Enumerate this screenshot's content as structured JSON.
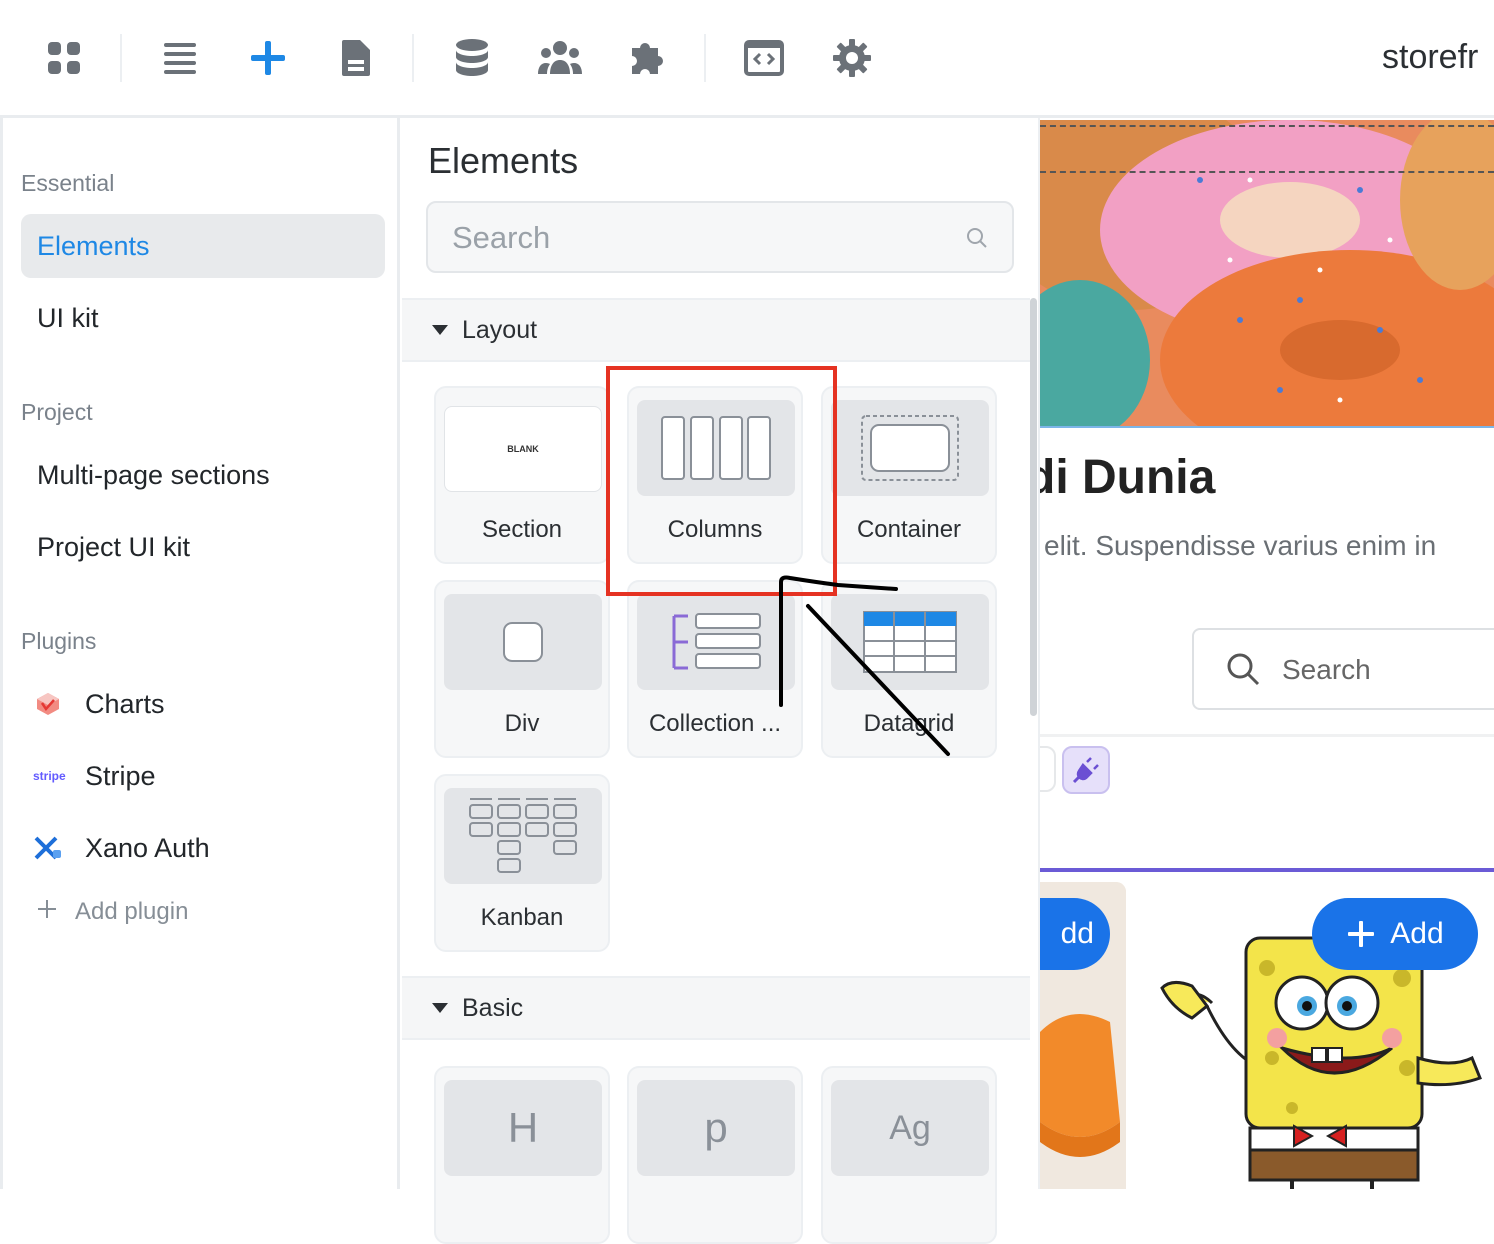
{
  "toolbar": {
    "icons": [
      "apps-grid-icon",
      "list-icon",
      "plus-icon",
      "page-icon",
      "database-icon",
      "users-icon",
      "puzzle-icon",
      "code-icon",
      "gear-icon"
    ],
    "project_title": "storefr",
    "accent": "#1e88e5"
  },
  "sidebar": {
    "essential_label": "Essential",
    "elements_label": "Elements",
    "uikit_label": "UI kit",
    "project_label": "Project",
    "multipage_label": "Multi-page sections",
    "project_uikit_label": "Project UI kit",
    "plugins_label": "Plugins",
    "plugins": [
      {
        "name": "Charts",
        "icon": "charts-logo-icon"
      },
      {
        "name": "Stripe",
        "icon": "stripe-logo-icon",
        "logo_text": "stripe"
      },
      {
        "name": "Xano Auth",
        "icon": "xano-logo-icon"
      }
    ],
    "add_plugin_label": "Add plugin"
  },
  "elements_panel": {
    "title": "Elements",
    "search_placeholder": "Search",
    "layout_group": "Layout",
    "layout_items": [
      {
        "label": "Section",
        "thumb_text": "BLANK"
      },
      {
        "label": "Columns"
      },
      {
        "label": "Container"
      },
      {
        "label": "Div"
      },
      {
        "label": "Collection ..."
      },
      {
        "label": "Datagrid"
      },
      {
        "label": "Kanban"
      }
    ],
    "basic_group": "Basic",
    "basic_items": [
      {
        "glyph": "H"
      },
      {
        "glyph": "p"
      },
      {
        "glyph": "Ag"
      }
    ],
    "highlight_color": "#e53222"
  },
  "canvas": {
    "heading": "di Dunia",
    "subtext": "elit. Suspendisse varius enim in",
    "search_placeholder": "Search",
    "add_label": "Add",
    "add_label_partial": "dd",
    "button_color": "#1a73e8",
    "divider_color": "#6b5bd6"
  }
}
